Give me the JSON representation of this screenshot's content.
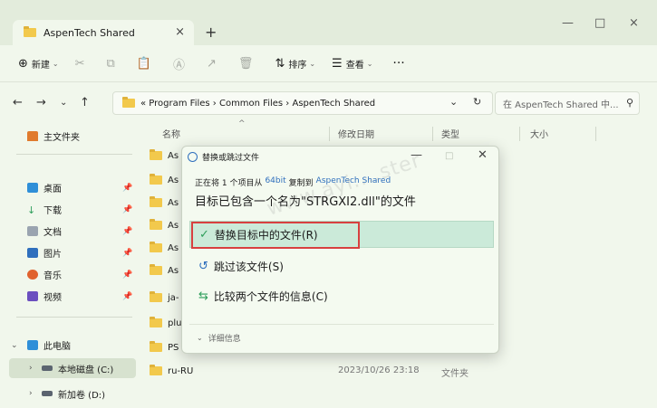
{
  "window": {
    "tab_title": "AspenTech Shared",
    "tab_close": "×",
    "new_tab": "+",
    "minimize": "—",
    "maximize": "□",
    "close": "×"
  },
  "toolbar": {
    "new_label": "新建",
    "sort_label": "排序",
    "view_label": "查看",
    "more_label": "···"
  },
  "address": {
    "path": "« Program Files  ›  Common Files  ›  AspenTech Shared",
    "search_placeholder": "在 AspenTech Shared 中..."
  },
  "sidebar": {
    "home": "主文件夹",
    "quick": [
      "桌面",
      "下载",
      "文档",
      "图片",
      "音乐",
      "视频"
    ],
    "this_pc": "此电脑",
    "local_disk": "本地磁盘 (C:)",
    "new_volume": "新加卷 (D:)"
  },
  "columns": {
    "name": "名称",
    "date": "修改日期",
    "type": "类型",
    "size": "大小"
  },
  "rows": [
    {
      "name": "As"
    },
    {
      "name": "As"
    },
    {
      "name": "As"
    },
    {
      "name": "As"
    },
    {
      "name": "As"
    },
    {
      "name": "As"
    },
    {
      "name": "ja-"
    },
    {
      "name": "plu"
    },
    {
      "name": "PS"
    },
    {
      "name": "ru-RU",
      "date": "2023/10/26 23:18",
      "type": "文件夹"
    }
  ],
  "dialog": {
    "title": "替换或跳过文件",
    "info_prefix": "正在将 1 个项目从",
    "source": "64bit",
    "info_mid": "复制到",
    "destination": "AspenTech Shared",
    "heading": "目标已包含一个名为\"STRGXI2.dll\"的文件",
    "replace_option": "替换目标中的文件(R)",
    "skip_option": "跳过该文件(S)",
    "compare_option": "比较两个文件的信息(C)",
    "details": "详细信息",
    "minimize": "—",
    "maximize": "□",
    "close": "✕",
    "watermark": "www.ayi....ster"
  },
  "colors": {
    "accent": "#2f6fbd",
    "replace_bg": "#cbead9",
    "highlight": "#d84040",
    "folder": "#f2c94c"
  }
}
